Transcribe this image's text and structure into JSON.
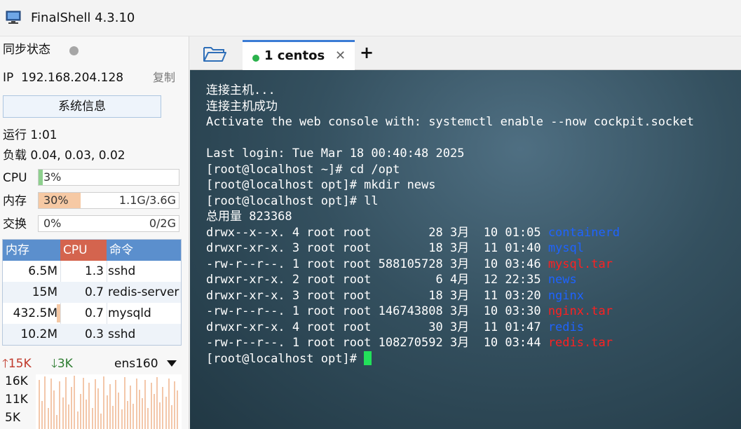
{
  "app": {
    "title": "FinalShell 4.3.10"
  },
  "left": {
    "sync_label": "同步状态",
    "ip_label": "IP",
    "ip": "192.168.204.128",
    "copy_label": "复制",
    "sysinfo_button": "系统信息",
    "uptime": "运行 1:01",
    "load": "负载 0.04, 0.03, 0.02",
    "meters": [
      {
        "label": "CPU",
        "percent_text": "3%",
        "amount": "",
        "fill": 0.03,
        "color": "#8ed08e"
      },
      {
        "label": "内存",
        "percent_text": "30%",
        "amount": "1.1G/3.6G",
        "fill": 0.3,
        "color": "#f6c9a4"
      },
      {
        "label": "交换",
        "percent_text": "0%",
        "amount": "0/2G",
        "fill": 0.0,
        "color": "#f6c9a4"
      }
    ],
    "process_table": {
      "headers": [
        {
          "label": "内存",
          "color": "#5b8fcd"
        },
        {
          "label": "CPU",
          "color": "#d4644e"
        },
        {
          "label": "命令",
          "color": "#5b8fcd"
        }
      ],
      "rows": [
        {
          "mem": "6.5M",
          "cpu": "1.3",
          "cmd": "sshd",
          "mem_bar": false
        },
        {
          "mem": "15M",
          "cpu": "0.7",
          "cmd": "redis-server",
          "mem_bar": false
        },
        {
          "mem": "432.5M",
          "cpu": "0.7",
          "cmd": "mysqld",
          "mem_bar": true
        },
        {
          "mem": "10.2M",
          "cpu": "0.3",
          "cmd": "sshd",
          "mem_bar": false
        }
      ]
    },
    "network": {
      "up": "15K",
      "down": "3K",
      "interface": "ens160",
      "axis": [
        "16K",
        "11K",
        "5K"
      ]
    }
  },
  "tabs": [
    {
      "label": "1 centos",
      "active": true,
      "status_color": "#2bb24c"
    }
  ],
  "terminal": {
    "lines": [
      [
        {
          "t": "连接主机..."
        }
      ],
      [
        {
          "t": "连接主机成功"
        }
      ],
      [
        {
          "t": "Activate the web console with: systemctl enable --now cockpit.socket"
        }
      ],
      [
        {
          "t": ""
        }
      ],
      [
        {
          "t": "Last login: Tue Mar 18 00:40:48 2025"
        }
      ],
      [
        {
          "t": "[root@localhost ~]# cd /opt"
        }
      ],
      [
        {
          "t": "[root@localhost opt]# mkdir news"
        }
      ],
      [
        {
          "t": "[root@localhost opt]# ll"
        }
      ],
      [
        {
          "t": "总用量 823368"
        }
      ],
      [
        {
          "t": "drwx--x--x. 4 root root        28 3月  10 01:05 "
        },
        {
          "t": "containerd",
          "c": "dir"
        }
      ],
      [
        {
          "t": "drwxr-xr-x. 3 root root        18 3月  11 01:40 "
        },
        {
          "t": "mysql",
          "c": "dir"
        }
      ],
      [
        {
          "t": "-rw-r--r--. 1 root root 588105728 3月  10 03:46 "
        },
        {
          "t": "mysql.tar",
          "c": "arc"
        }
      ],
      [
        {
          "t": "drwxr-xr-x. 2 root root         6 4月  12 22:35 "
        },
        {
          "t": "news",
          "c": "dir"
        }
      ],
      [
        {
          "t": "drwxr-xr-x. 3 root root        18 3月  11 03:20 "
        },
        {
          "t": "nginx",
          "c": "dir"
        }
      ],
      [
        {
          "t": "-rw-r--r--. 1 root root 146743808 3月  10 03:30 "
        },
        {
          "t": "nginx.tar",
          "c": "arc"
        }
      ],
      [
        {
          "t": "drwxr-xr-x. 4 root root        30 3月  11 01:47 "
        },
        {
          "t": "redis",
          "c": "dir"
        }
      ],
      [
        {
          "t": "-rw-r--r--. 1 root root 108270592 3月  10 03:44 "
        },
        {
          "t": "redis.tar",
          "c": "arc"
        }
      ],
      [
        {
          "t": "[root@localhost opt]# "
        },
        {
          "cursor": true
        }
      ]
    ]
  }
}
